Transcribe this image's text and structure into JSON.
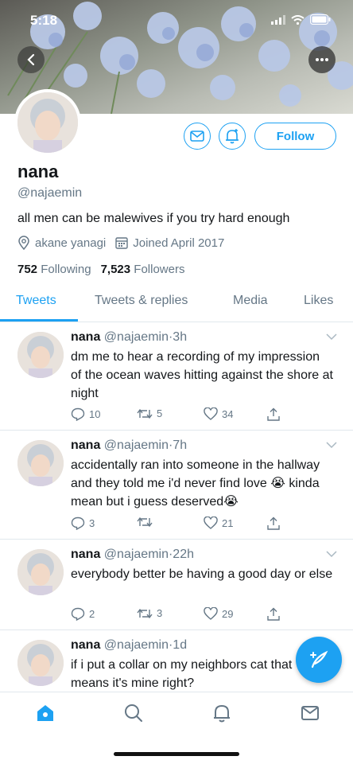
{
  "status_bar": {
    "time": "5:18"
  },
  "profile": {
    "name": "nana",
    "handle": "@najaemin",
    "bio": "all men can be malewives if you try hard enough",
    "location": "akane yanagi",
    "joined": "Joined April 2017",
    "following_count": "752",
    "following_label": "Following",
    "followers_count": "7,523",
    "followers_label": "Followers",
    "follow_label": "Follow"
  },
  "tabs": [
    {
      "label": "Tweets",
      "active": true
    },
    {
      "label": "Tweets & replies",
      "active": false
    },
    {
      "label": "Media",
      "active": false
    },
    {
      "label": "Likes",
      "active": false
    }
  ],
  "tweets": [
    {
      "name": "nana",
      "handle": "@najaemin",
      "time": "3h",
      "text": "dm me to hear a recording of my impression of the ocean waves hitting against the shore at night",
      "replies": "10",
      "retweets": "5",
      "likes": "34"
    },
    {
      "name": "nana",
      "handle": "@najaemin",
      "time": "7h",
      "text": "accidentally ran into someone in the hallway and they told me i'd never find love 😭 kinda mean but i guess deserved😭",
      "replies": "3",
      "retweets": "",
      "likes": "21"
    },
    {
      "name": "nana",
      "handle": "@najaemin",
      "time": "22h",
      "text": "everybody better be having a good day or else",
      "replies": "2",
      "retweets": "3",
      "likes": "29"
    },
    {
      "name": "nana",
      "handle": "@najaemin",
      "time": "1d",
      "text": "if i put a collar on my neighbors cat that means it's mine right?",
      "replies": "",
      "retweets": "",
      "likes": ""
    }
  ],
  "colors": {
    "accent": "#1da1f2",
    "muted": "#657786",
    "text": "#14171a"
  },
  "icons": {
    "back": "chevron-left-icon",
    "more": "more-icon",
    "message": "envelope-icon",
    "notify": "bell-plus-icon",
    "location": "location-pin-icon",
    "calendar": "calendar-icon",
    "reply": "reply-icon",
    "retweet": "retweet-icon",
    "like": "heart-icon",
    "share": "share-icon",
    "compose": "compose-icon",
    "home": "home-icon",
    "search": "search-icon",
    "notifications": "bell-icon",
    "messages": "envelope-icon"
  }
}
